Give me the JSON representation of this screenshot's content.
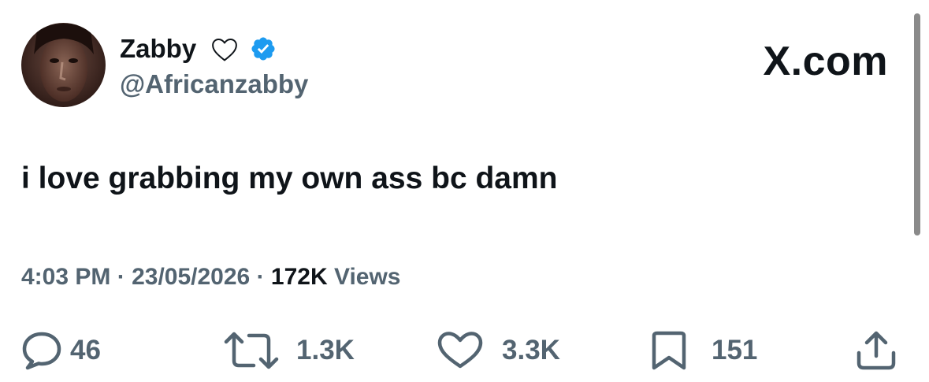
{
  "author": {
    "display_name": "Zabby",
    "handle": "@Africanzabby",
    "verified": true,
    "name_emoji": "heart-outline-icon"
  },
  "brand": "X.com",
  "tweet": {
    "text": "i love grabbing my own ass bc damn"
  },
  "meta": {
    "time": "4:03 PM",
    "separator": "·",
    "date": "23/05/2026",
    "views_count": "172K",
    "views_label": "Views"
  },
  "actions": {
    "replies": "46",
    "retweets": "1.3K",
    "likes": "3.3K",
    "bookmarks": "151"
  },
  "colors": {
    "text_primary": "#0f1419",
    "text_secondary": "#536471",
    "verified_blue": "#1d9bf0",
    "background": "#ffffff"
  }
}
